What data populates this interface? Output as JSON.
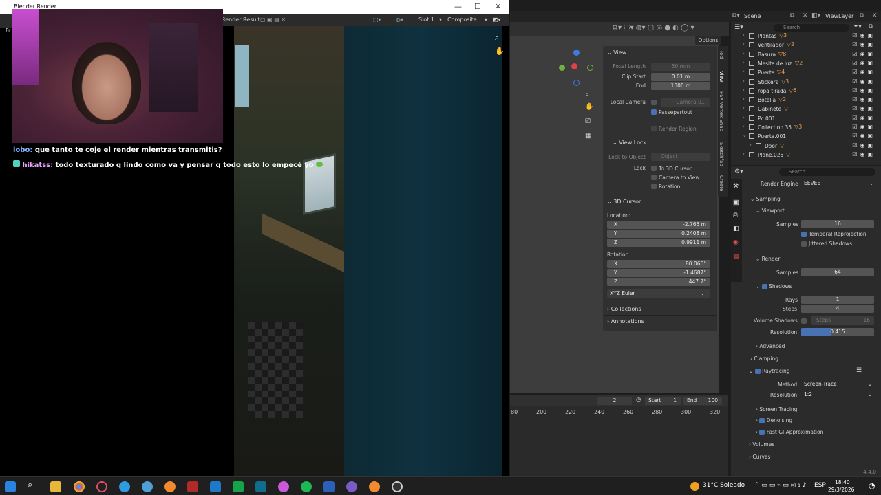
{
  "render_window": {
    "title": "Blender Render",
    "toolbar": {
      "image_name": "Render Result",
      "slot": "Slot 1",
      "layer": "Composite"
    },
    "side_label": "Fr"
  },
  "chat": [
    {
      "user": "lobo:",
      "message": "que tanto te coje el render mientras transmitis?"
    },
    {
      "user": "hikatss:",
      "message": "todo texturado q lindo como va y pensar q todo esto lo empecé yo"
    }
  ],
  "viewport": {
    "options_label": "Options",
    "npanel_tabs": [
      "Tool",
      "View",
      "PSX Vertex Snap",
      "Sketchfab",
      "Create"
    ],
    "view_panel": {
      "title": "View",
      "focal_length_label": "Focal Length",
      "focal_length": "50 mm",
      "clip_start_label": "Clip Start",
      "clip_start": "0.01 m",
      "end_label": "End",
      "end": "1000 m",
      "local_camera_label": "Local Camera",
      "local_camera": "Camera.0...",
      "passepartout_label": "Passepartout",
      "render_region_label": "Render Region"
    },
    "view_lock": {
      "title": "View Lock",
      "lock_to_object_label": "Lock to Object",
      "lock_to_object": "Object",
      "lock_label": "Lock",
      "to_3d_cursor": "To 3D Cursor",
      "camera_to_view": "Camera to View",
      "rotation": "Rotation"
    },
    "cursor_panel": {
      "title": "3D Cursor",
      "location_label": "Location:",
      "x_label": "X",
      "y_label": "Y",
      "z_label": "Z",
      "loc_x": "-2.765 m",
      "loc_y": "0.2408 m",
      "loc_z": "0.9911 m",
      "rotation_label": "Rotation:",
      "rot_x": "80.066°",
      "rot_y": "-1.4687°",
      "rot_z": "447.7°",
      "rotation_mode": "XYZ Euler"
    },
    "collections_label": "Collections",
    "annotations_label": "Annotations"
  },
  "timeline": {
    "current_frame": "2",
    "start_label": "Start",
    "start": "1",
    "end_label": "End",
    "end": "100",
    "ticks": [
      "80",
      "200",
      "220",
      "240",
      "260",
      "280",
      "300",
      "320"
    ]
  },
  "topbar": {
    "scene": "Scene",
    "view_layer": "ViewLayer"
  },
  "outliner": {
    "search_placeholder": "Search",
    "rows": [
      {
        "name": "Plantas",
        "sub": "▽3"
      },
      {
        "name": "Ventilador",
        "sub": "▽2"
      },
      {
        "name": "Basura",
        "sub": "▽8"
      },
      {
        "name": "Mesita de luz",
        "sub": "▽2"
      },
      {
        "name": "Puerta",
        "sub": "▽4"
      },
      {
        "name": "Stickers",
        "sub": "▽3"
      },
      {
        "name": "ropa tirada",
        "sub": "▽6"
      },
      {
        "name": "Botella",
        "sub": "▽2"
      },
      {
        "name": "Gabinete",
        "sub": "▽"
      },
      {
        "name": "Pc.001",
        "sub": ""
      },
      {
        "name": "Collection 35",
        "sub": "▽3"
      },
      {
        "name": "Puerta.001",
        "sub": ""
      },
      {
        "name": "Door",
        "sub": "▽"
      },
      {
        "name": "Plane.025",
        "sub": "▽"
      }
    ]
  },
  "properties": {
    "search_placeholder": "Search",
    "render_engine_label": "Render Engine",
    "render_engine": "EEVEE",
    "sampling": "Sampling",
    "viewport": "Viewport",
    "samples_label": "Samples",
    "viewport_samples": "16",
    "temporal_reprojection": "Temporal Reprojection",
    "jittered_shadows": "Jittered Shadows",
    "render": "Render",
    "render_samples": "64",
    "shadows": "Shadows",
    "rays_label": "Rays",
    "rays": "1",
    "steps_label": "Steps",
    "steps": "4",
    "volume_shadows_label": "Volume Shadows",
    "volume_steps_label": "Steps",
    "volume_steps": "16",
    "resolution_label": "Resolution",
    "shadow_resolution": "0.415",
    "shadow_resolution_fraction": 0.415,
    "advanced": "Advanced",
    "clamping": "Clamping",
    "raytracing": "Raytracing",
    "method_label": "Method",
    "method": "Screen-Trace",
    "rt_resolution_label": "Resolution",
    "rt_resolution": "1:2",
    "screen_tracing": "Screen Tracing",
    "denoising": "Denoising",
    "fast_gi": "Fast GI Approximation",
    "volumes": "Volumes",
    "curves": "Curves",
    "version": "4.4.0"
  },
  "taskbar": {
    "weather": "31°C  Soleado",
    "language": "ESP",
    "time": "18:40",
    "date": "29/3/2026"
  }
}
